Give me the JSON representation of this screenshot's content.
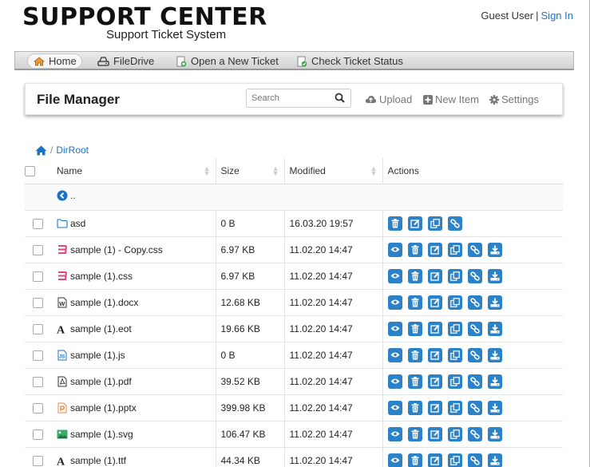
{
  "header": {
    "title": "SUPPORT CENTER",
    "subtitle": "Support Ticket System",
    "guest": "Guest User",
    "separator": "|",
    "signin": "Sign In"
  },
  "nav": {
    "home": "Home",
    "filedrive": "FileDrive",
    "new_ticket": "Open a New Ticket",
    "check_status": "Check Ticket Status"
  },
  "file_manager": {
    "title": "File Manager",
    "search_placeholder": "Search",
    "upload": "Upload",
    "new_item": "New Item",
    "settings": "Settings"
  },
  "breadcrumb": {
    "separator": "/",
    "current": "DirRoot"
  },
  "table": {
    "headers": {
      "name": "Name",
      "size": "Size",
      "modified": "Modified",
      "actions": "Actions"
    },
    "parent_label": "..",
    "rows": [
      {
        "name": "asd",
        "size": "0 B",
        "modified": "16.03.20 19:57",
        "icon": "folder-icon"
      },
      {
        "name": "sample (1) - Copy.css",
        "size": "6.97 KB",
        "modified": "11.02.20 14:47",
        "icon": "css-file-icon"
      },
      {
        "name": "sample (1).css",
        "size": "6.97 KB",
        "modified": "11.02.20 14:47",
        "icon": "css-file-icon"
      },
      {
        "name": "sample (1).docx",
        "size": "12.68 KB",
        "modified": "11.02.20 14:47",
        "icon": "word-file-icon"
      },
      {
        "name": "sample (1).eot",
        "size": "19.66 KB",
        "modified": "11.02.20 14:47",
        "icon": "font-file-icon"
      },
      {
        "name": "sample (1).js",
        "size": "0 B",
        "modified": "11.02.20 14:47",
        "icon": "js-file-icon"
      },
      {
        "name": "sample (1).pdf",
        "size": "39.52 KB",
        "modified": "11.02.20 14:47",
        "icon": "pdf-file-icon"
      },
      {
        "name": "sample (1).pptx",
        "size": "399.98 KB",
        "modified": "11.02.20 14:47",
        "icon": "pptx-file-icon"
      },
      {
        "name": "sample (1).svg",
        "size": "106.47 KB",
        "modified": "11.02.20 14:47",
        "icon": "image-file-icon"
      },
      {
        "name": "sample (1).ttf",
        "size": "44.34 KB",
        "modified": "11.02.20 14:47",
        "icon": "font-file-icon"
      }
    ]
  },
  "colors": {
    "accent": "#2b82c9",
    "link": "#1a73c7",
    "css_icon": "#e8457a",
    "image_icon": "#3aaa6b",
    "pptx_icon": "#e8853a"
  }
}
